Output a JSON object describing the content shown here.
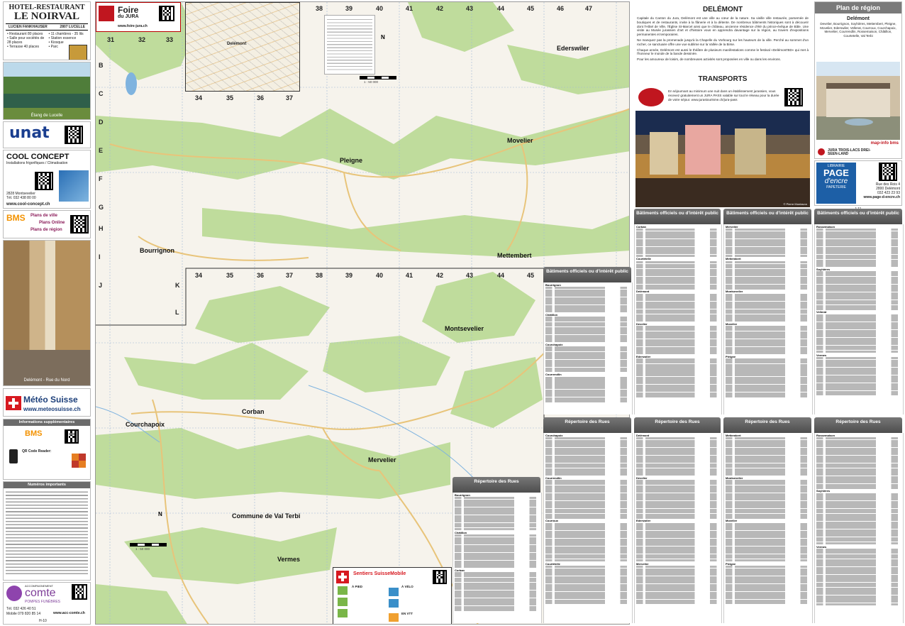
{
  "left_ads": {
    "hotel": {
      "line1": "HOTEL-RESTAURANT",
      "line2": "LE NOIRVAL",
      "owner": "LUCIEN FANKHAUSER",
      "city": "2807 LUCELLE",
      "features": [
        "• Restaurant 80 places",
        "• Salle pour sociétés de 28 places",
        "• Terrasse 40 places",
        "• 11 chambres - 35 lits",
        "• Station essence",
        "• Kiosque",
        "• Parc"
      ]
    },
    "photo_caption": "Étang de Lucelle",
    "unat": "unat",
    "cool": {
      "name": "COOL CONCEPT",
      "tagline": "Installations frigorifiques / Climatisation",
      "address": "2828 Montsevelier",
      "phone": "Tél. 032 438 80 00",
      "web": "www.cool-concept.ch"
    },
    "bms": {
      "logo": "BMS",
      "plans_ville": "Plans de ville",
      "plans_online": "Plans Online",
      "plans_region": "Plans de région"
    },
    "street_caption": "Delémont - Rue du Nord",
    "meteo": {
      "name": "Météo Suisse",
      "web": "www.meteosuisse.ch"
    },
    "info_title": "Informations supplémentaires",
    "qr_title": "QR Code Reader:",
    "numbers_title": "Numéros importants",
    "comte": {
      "pre": "ACCOMPAGNEMENT",
      "name": "comte",
      "sub": "POMPES FUNÈBRES",
      "phone": "Tél. 032 426 40 51",
      "mobile": "Mobile 079 820 85 14",
      "web": "www.acc-comte.ch"
    },
    "page_ref": "H-10"
  },
  "map": {
    "foire": {
      "name": "Foire",
      "sub": "du JURA",
      "web": "www.foire-jura.ch"
    },
    "inset_label": "Delémont",
    "grid_top": [
      "31",
      "32",
      "33",
      "34",
      "35",
      "36",
      "37",
      "38",
      "39",
      "40",
      "41",
      "42",
      "43",
      "44",
      "45",
      "46",
      "47"
    ],
    "grid_left": [
      "B",
      "C",
      "D",
      "E",
      "F",
      "G",
      "H",
      "I",
      "J",
      "K",
      "L"
    ],
    "towns": {
      "pleigne": "Pleigne",
      "movelier": "Movelier",
      "ederswiler": "Ederswiler",
      "bourrignon": "Bourrignon",
      "mettembert": "Mettembert",
      "montsevelier": "Montsevelier",
      "corban": "Corban",
      "courchapoix": "Courchapoix",
      "mervelier": "Mervelier",
      "valterbi": "Commune de Val Terbi",
      "vermes": "Vermes"
    },
    "scale": "1 : 50 000",
    "north": "N",
    "sentiers": {
      "title": "Sentiers SuisseMobile",
      "a_pied": "À PIED",
      "a_velo": "À VÉLO",
      "en_vtt": "EN VTT"
    }
  },
  "right": {
    "delemont_title": "DELÉMONT",
    "delemont_paras": [
      "Capitale du Canton du Jura, Delémont est une ville au cœur de la nature. Sa vieille ville restaurée, parsemée de boutiques et de restaurants, invite à la flânerie et à la détente. De nombreux bâtiments historiques sont à découvrir dont l'Hôtel de Ville, l'Église St-Marcel ainsi que le château, ancienne résidence d'été du prince-évêque de Bâle. Une visite au Musée jurassien d'art et d'histoire vous en apprendra davantage sur la région, au travers d'expositions permanentes et temporaires.",
      "Ne manquez pas la promenade jusqu'à la Chapelle du Vorbourg sur les hauteurs de la ville. Perché au sommet d'un rocher, ce sanctuaire offre une vue sublime sur la Vallée de la Birse.",
      "Chaque année, Delémont est aussi le théâtre de plusieurs manifestations comme le festival «Delémont'BD» qui met à l'honneur le monde de la bande dessinée.",
      "Pour les amoureux de loisirs, de nombreuses activités sont proposées en ville ou dans les environs."
    ],
    "transports_title": "TRANSPORTS",
    "transports_text": "En séjournant au minimum une nuit dans un établissement jurassien, vous recevez gratuitement un JURA PASS valable sur tout le réseau pour la durée de votre séjour. www.jurastourisme.ch/jura-pass",
    "plan_region": {
      "title": "Plan de région",
      "town": "Delémont",
      "communes": "Develier, Bourrignon, Soyhières, Mettembert, Pleigne, Movelier, Ederswiler, Vellerat, Courroux, Courchapoix, Mervelier, Courrendlin, Rossemaison, Châtillon, Courtetelle, Val Terbi",
      "brand": "map-info bms",
      "jura": "JURA TROIS-LACS DREI-SEEN-LAND"
    },
    "page_encre": {
      "line1": "LIBRAIRIE",
      "line2": "PAGE",
      "line3": "d'encre",
      "line4": "PAPETERIE",
      "address": "Rue des Rois 4",
      "city": "2800 Delémont",
      "phone": "032 423 23 93",
      "web": "www.page-d-encre.ch"
    },
    "photo_credit": "© Pierre Montavon",
    "page_num": "J-11",
    "col_batiments": "Bâtiments officiels ou d'intérêt public",
    "col_rues": "Répertoire des Rues",
    "sections_bat": [
      "Bourrignon",
      "Châtillon",
      "Courchapoix",
      "Courrendlin",
      "Corban",
      "Courtételle",
      "Delémont",
      "Develier",
      "Ederswiler",
      "Mervelier",
      "Mettembert",
      "Montsevelier",
      "Movelier",
      "Pleigne",
      "Rossemaison",
      "Soyhières",
      "Vellerat",
      "Vermes"
    ],
    "sections_rues": [
      "Bourrignon",
      "Châtillon",
      "Corban",
      "Courchapoix",
      "Courrendlin",
      "Courroux",
      "Courtételle",
      "Delémont",
      "Develier",
      "Ederswiler",
      "Mervelier",
      "Mettembert",
      "Montsevelier",
      "Movelier",
      "Pleigne",
      "Rossemaison",
      "Soyhières",
      "Vermes"
    ]
  }
}
